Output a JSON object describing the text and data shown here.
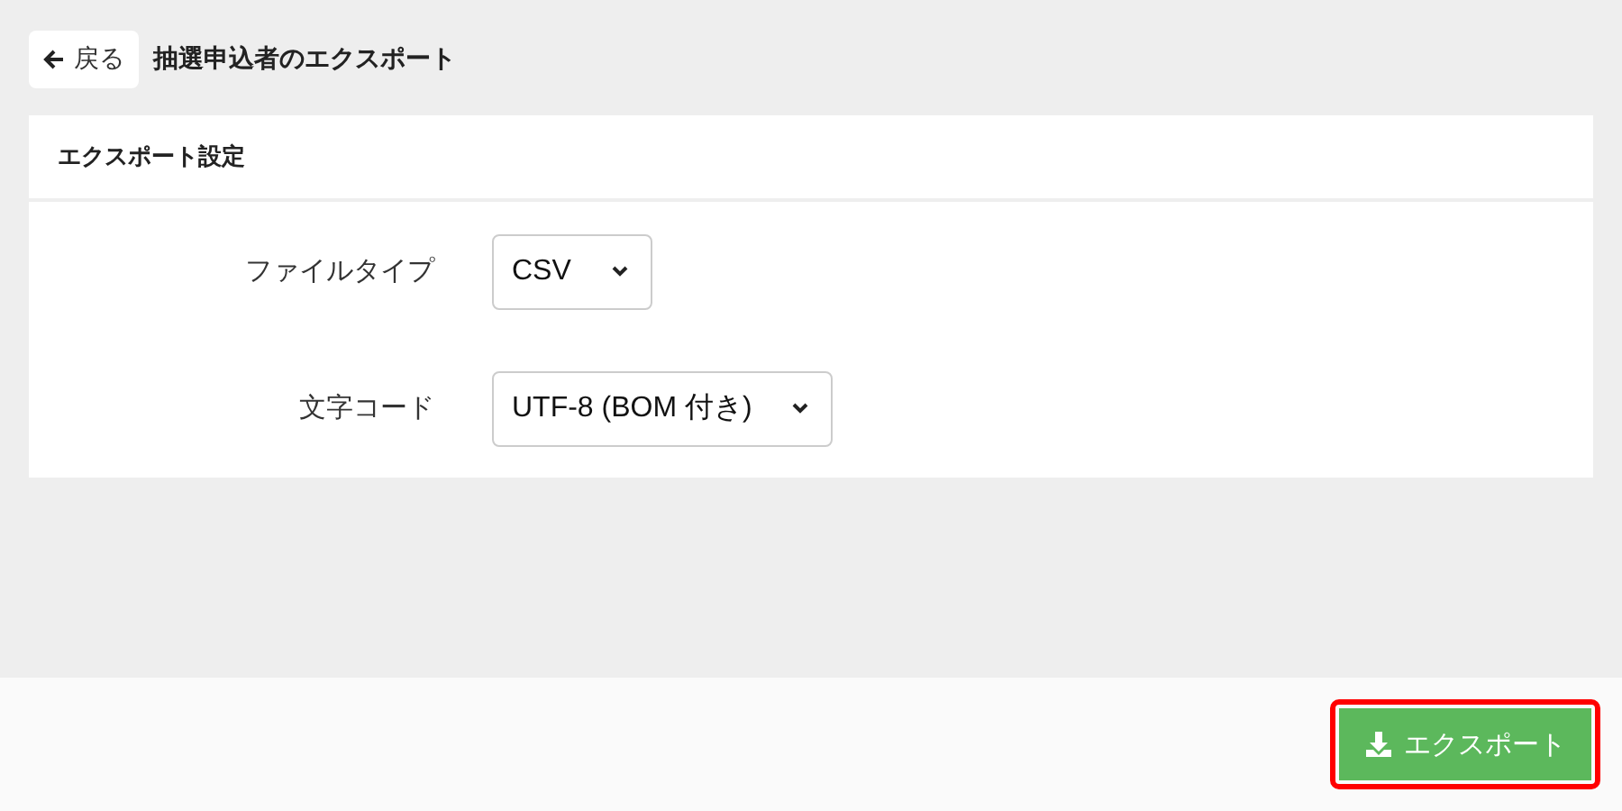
{
  "header": {
    "back_button": "戻る",
    "title": "抽選申込者のエクスポート"
  },
  "settings_card": {
    "title": "エクスポート設定",
    "fields": [
      {
        "label": "ファイルタイプ",
        "value": "CSV"
      },
      {
        "label": "文字コード",
        "value": "UTF-8 (BOM 付き)"
      }
    ]
  },
  "footer": {
    "export_button": {
      "label": "エクスポート",
      "highlighted": true
    }
  }
}
